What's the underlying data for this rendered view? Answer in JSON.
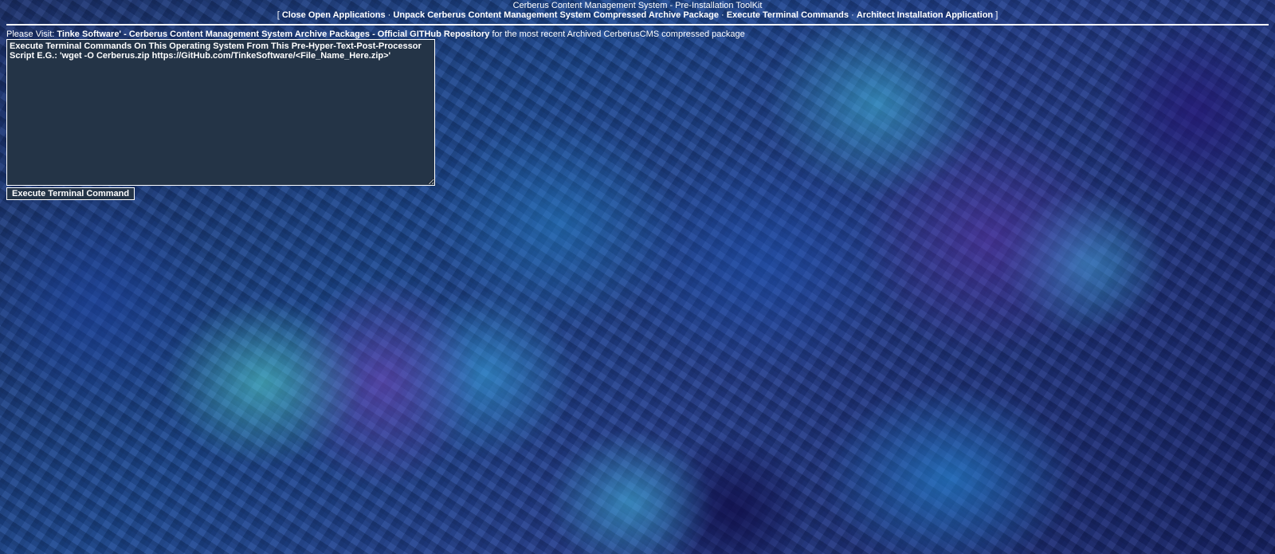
{
  "header": {
    "title": "Cerberus Content Management System - Pre-Installation ToolKit",
    "bracket_open": "[",
    "bracket_close": "]",
    "separator": "·",
    "nav": [
      {
        "label": "Close Open Applications"
      },
      {
        "label": "Unpack Cerberus Content Management System Compressed Archive Package"
      },
      {
        "label": "Execute Terminal Commands"
      },
      {
        "label": "Architect Installation Application"
      }
    ]
  },
  "visit": {
    "prefix": "Please Visit:",
    "link_label": "Tinke Software' - Cerberus Content Management System Archive Packages - Official GITHub Repository",
    "suffix": "for the most recent Archived CerberusCMS compressed package"
  },
  "terminal": {
    "value": "",
    "placeholder": "Execute Terminal Commands On This Operating System From This Pre-Hyper-Text-Post-Processor Script E.G.: 'wget -O Cerberus.zip https://GitHub.com/TinkeSoftware/<File_Name_Here.zip>'",
    "button_label": "Execute Terminal Command"
  },
  "colors": {
    "text": "#ffffff",
    "input_background": "#243447",
    "border": "#ffffff"
  }
}
